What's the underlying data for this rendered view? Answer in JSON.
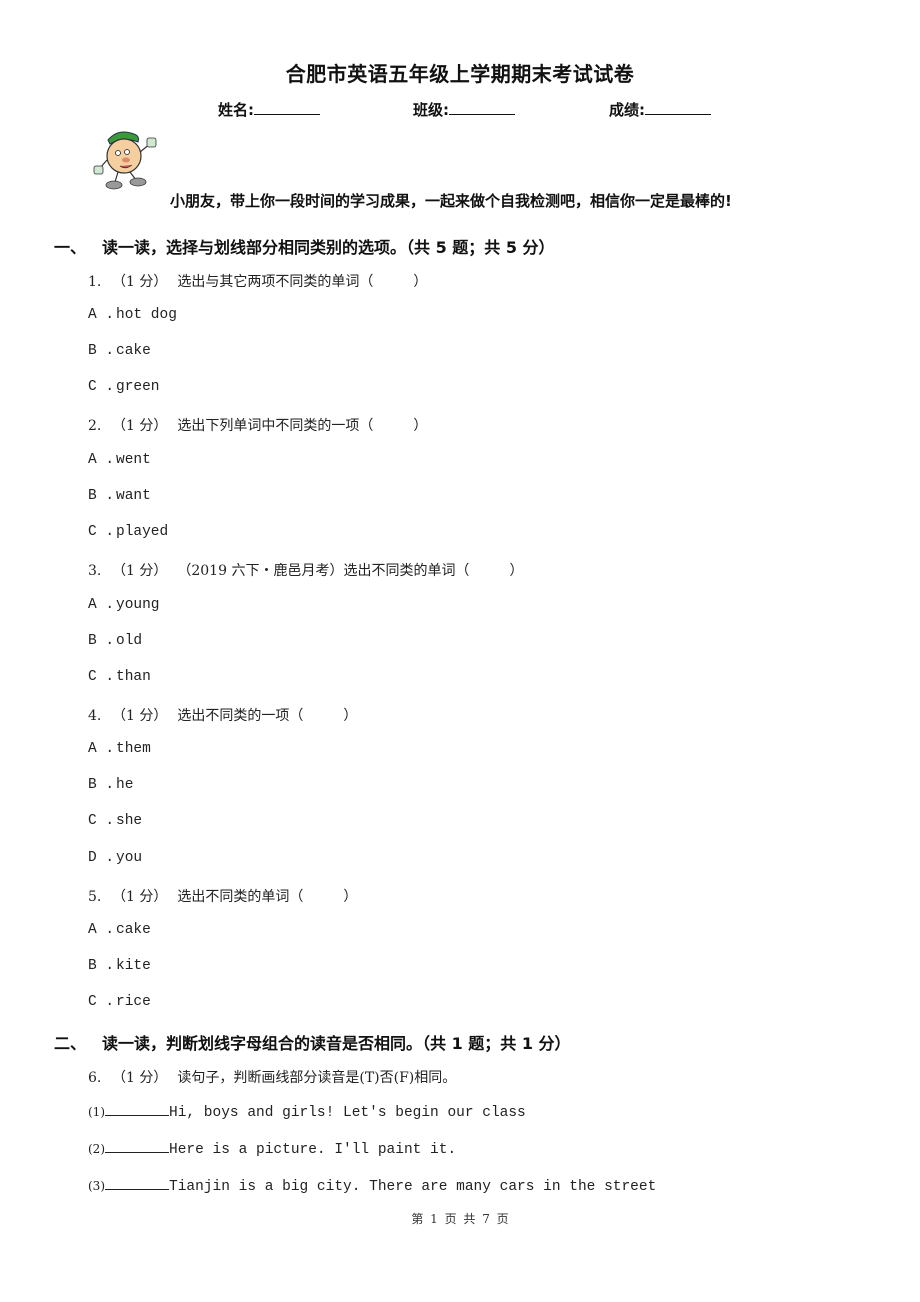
{
  "document": {
    "title": "合肥市英语五年级上学期期末考试试卷",
    "info_fields": [
      {
        "label": "姓名:",
        "value": ""
      },
      {
        "label": "班级:",
        "value": ""
      },
      {
        "label": "成绩:",
        "value": ""
      }
    ],
    "mascot_icon": "cartoon-mascot-icon",
    "encouragement": "小朋友，带上你一段时间的学习成果，一起来做个自我检测吧，相信你一定是最棒的!"
  },
  "sections": [
    {
      "number": "一、",
      "heading": "读一读，选择与划线部分相同类别的选项。（共 5 题；共 5 分）",
      "questions": [
        {
          "number": "1.",
          "points": "（1 分）",
          "prompt": "选出与其它两项不同类的单词（",
          "close": "）",
          "options": [
            {
              "letter": "A .",
              "text": "hot dog"
            },
            {
              "letter": "B .",
              "text": "cake"
            },
            {
              "letter": "C .",
              "text": "green"
            }
          ]
        },
        {
          "number": "2.",
          "points": "（1 分）",
          "prompt": "选出下列单词中不同类的一项（",
          "close": "）",
          "options": [
            {
              "letter": "A .",
              "text": "went"
            },
            {
              "letter": "B .",
              "text": "want"
            },
            {
              "letter": "C .",
              "text": "played"
            }
          ]
        },
        {
          "number": "3.",
          "points": "（1 分）",
          "prompt": "（2019 六下・鹿邑月考）选出不同类的单词（",
          "close": "）",
          "options": [
            {
              "letter": "A .",
              "text": "young"
            },
            {
              "letter": "B .",
              "text": "old"
            },
            {
              "letter": "C .",
              "text": "than"
            }
          ]
        },
        {
          "number": "4.",
          "points": "（1 分）",
          "prompt": "选出不同类的一项（",
          "close": "）",
          "options": [
            {
              "letter": "A .",
              "text": "them"
            },
            {
              "letter": "B .",
              "text": "he"
            },
            {
              "letter": "C .",
              "text": "she"
            },
            {
              "letter": "D .",
              "text": "you"
            }
          ]
        },
        {
          "number": "5.",
          "points": "（1 分）",
          "prompt": "选出不同类的单词（",
          "close": "）",
          "options": [
            {
              "letter": "A .",
              "text": "cake"
            },
            {
              "letter": "B .",
              "text": "kite"
            },
            {
              "letter": "C .",
              "text": "rice"
            }
          ]
        }
      ]
    },
    {
      "number": "二、",
      "heading": "读一读，判断划线字母组合的读音是否相同。（共 1 题；共 1 分）",
      "questions": [
        {
          "number": "6.",
          "points": "（1 分）",
          "prompt": "读句子，判断画线部分读音是(T)否(F)相同。",
          "items": [
            {
              "index": "(1)",
              "answer": "",
              "text": "Hi, boys and girls! Let's begin our class"
            },
            {
              "index": "(2)",
              "answer": "",
              "text": "Here is a picture. I'll paint it."
            },
            {
              "index": "(3)",
              "answer": "",
              "text": "Tianjin is a big city. There are many cars in the street"
            }
          ]
        }
      ]
    }
  ],
  "footer": {
    "page_label": "第 1 页 共 7 页"
  }
}
